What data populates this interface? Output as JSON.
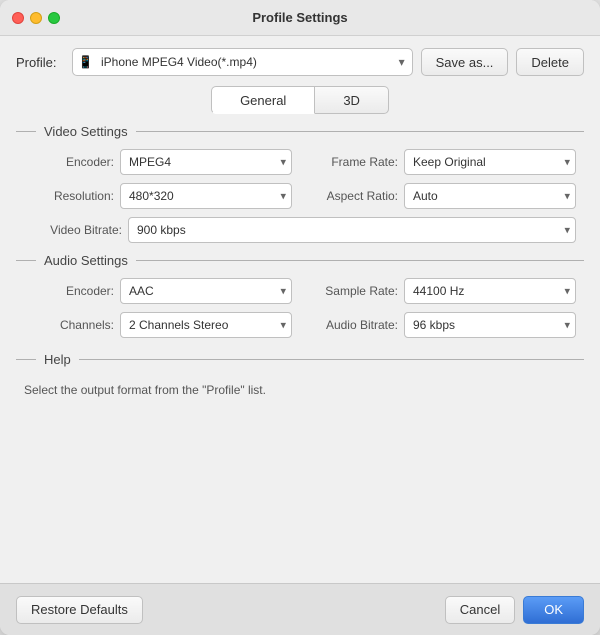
{
  "titlebar": {
    "title": "Profile Settings"
  },
  "profile": {
    "label": "Profile:",
    "selected": "iPhone MPEG4 Video(*.mp4)",
    "save_btn": "Save as...",
    "delete_btn": "Delete"
  },
  "tabs": {
    "general": "General",
    "three_d": "3D",
    "active": "General"
  },
  "video_settings": {
    "title": "Video Settings",
    "encoder_label": "Encoder:",
    "encoder_value": "MPEG4",
    "resolution_label": "Resolution:",
    "resolution_value": "480*320",
    "video_bitrate_label": "Video Bitrate:",
    "video_bitrate_value": "900 kbps",
    "frame_rate_label": "Frame Rate:",
    "frame_rate_value": "Keep Original",
    "aspect_ratio_label": "Aspect Ratio:",
    "aspect_ratio_value": "Auto"
  },
  "audio_settings": {
    "title": "Audio Settings",
    "encoder_label": "Encoder:",
    "encoder_value": "AAC",
    "channels_label": "Channels:",
    "channels_value": "2 Channels Stereo",
    "sample_rate_label": "Sample Rate:",
    "sample_rate_value": "44100 Hz",
    "audio_bitrate_label": "Audio Bitrate:",
    "audio_bitrate_value": "96 kbps"
  },
  "help": {
    "title": "Help",
    "text": "Select the output format from the \"Profile\" list."
  },
  "footer": {
    "restore_btn": "Restore Defaults",
    "cancel_btn": "Cancel",
    "ok_btn": "OK"
  }
}
